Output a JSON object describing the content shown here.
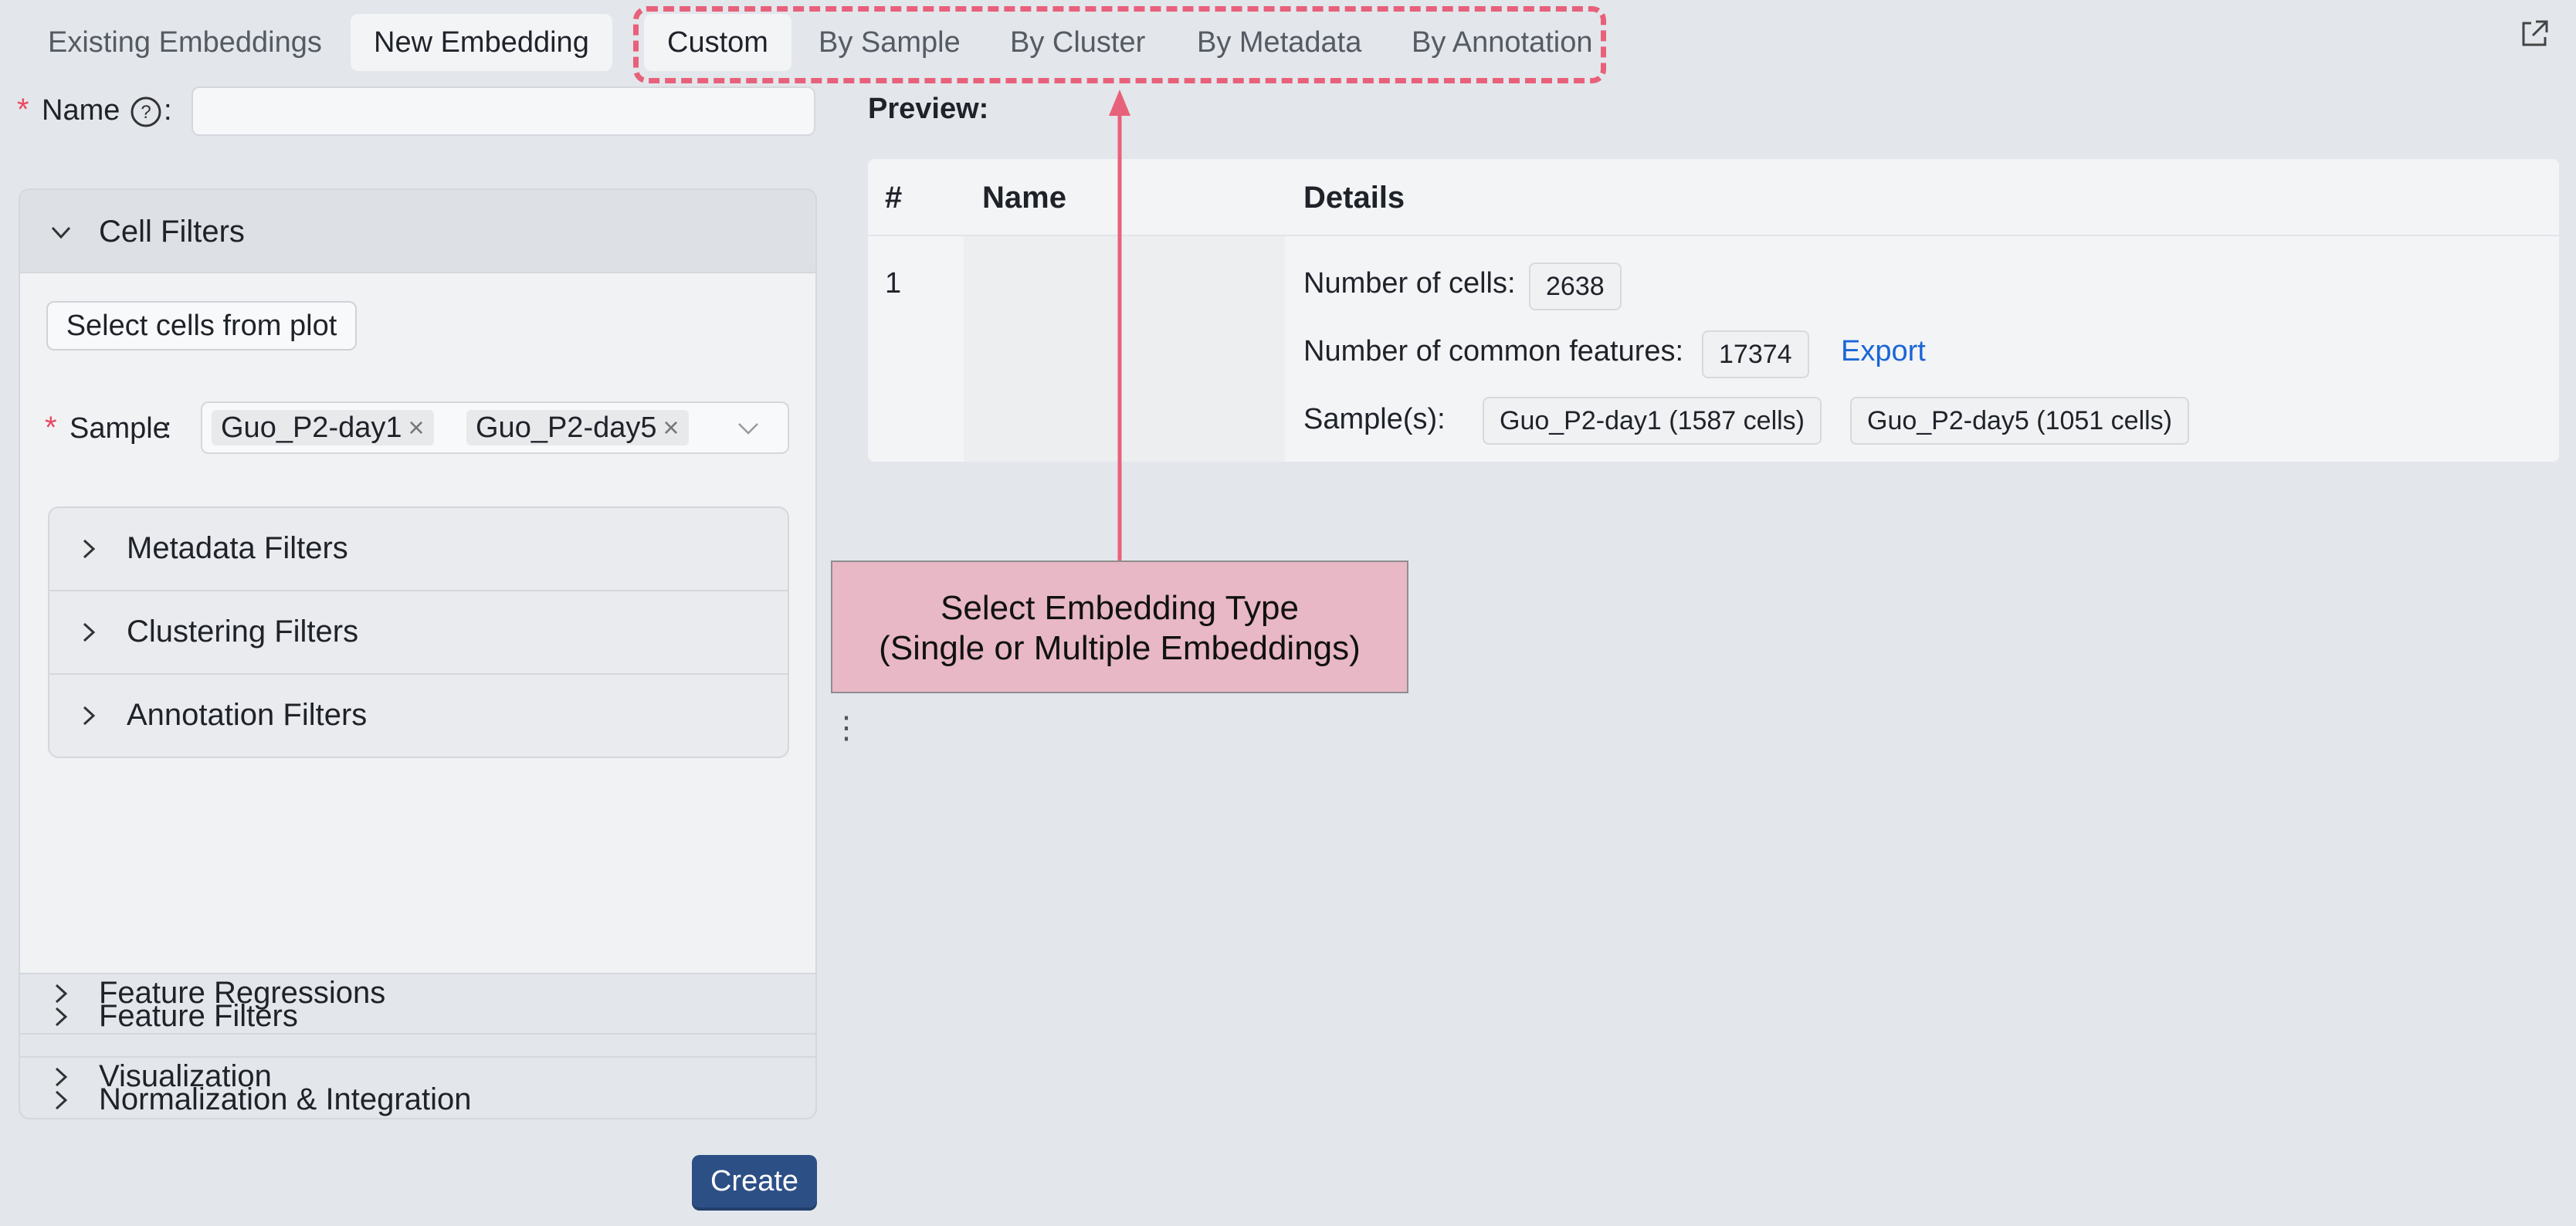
{
  "tabs": {
    "main": [
      {
        "label": "Existing Embeddings",
        "active": false
      },
      {
        "label": "New Embedding",
        "active": true
      }
    ],
    "type": [
      {
        "label": "Custom",
        "active": true
      },
      {
        "label": "By Sample",
        "active": false
      },
      {
        "label": "By Cluster",
        "active": false
      },
      {
        "label": "By Metadata",
        "active": false
      },
      {
        "label": "By Annotation",
        "active": false
      }
    ]
  },
  "form": {
    "name_label": "Name",
    "name_colon": ":",
    "required_mark": "*",
    "name_value": "",
    "help_icon": "question-circle-icon"
  },
  "cell_filters": {
    "title": "Cell Filters",
    "select_cells_button": "Select cells from plot",
    "sample_label": "Sample",
    "sample_colon": ":",
    "samples_selected": [
      "Guo_P2-day1",
      "Guo_P2-day5"
    ],
    "remove_glyph": "×",
    "subfilters": [
      "Metadata Filters",
      "Clustering Filters",
      "Annotation Filters"
    ]
  },
  "collapsed_sections": [
    "Feature Filters",
    "Normalization & Integration",
    "Feature Regressions",
    "Visualization"
  ],
  "create_button": "Create",
  "preview": {
    "title": "Preview:",
    "columns": [
      "#",
      "Name",
      "Details"
    ],
    "row": {
      "index": "1",
      "name": "",
      "cells_label": "Number of cells:",
      "cells_value": "2638",
      "features_label": "Number of common features:",
      "features_value": "17374",
      "export_link": "Export",
      "samples_label": "Sample(s):",
      "samples": [
        "Guo_P2-day1 (1587 cells)",
        "Guo_P2-day5 (1051 cells)"
      ]
    }
  },
  "annotation": {
    "line1": "Select Embedding Type",
    "line2": "(Single or Multiple Embeddings)",
    "color": "#e8617a",
    "fill": "#e8b8c6"
  },
  "misc": {
    "splitter_glyph": "⋮",
    "open_external_icon": "open-external-icon"
  },
  "colors": {
    "background": "#e3e6eb",
    "primary_button": "#2c4f86",
    "link": "#1a66d6",
    "required": "#e8495f"
  }
}
